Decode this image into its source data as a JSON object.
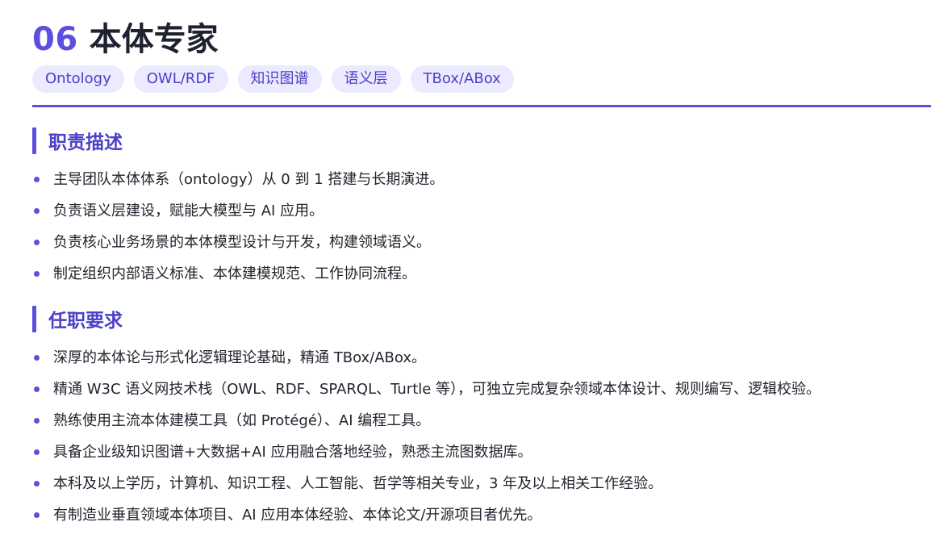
{
  "header": {
    "number": "06",
    "title": "本体专家"
  },
  "tags": [
    "Ontology",
    "OWL/RDF",
    "知识图谱",
    "语义层",
    "TBox/ABox"
  ],
  "sections": [
    {
      "title": "职责描述",
      "items": [
        "主导团队本体体系（ontology）从 0 到 1 搭建与长期演进。",
        "负责语义层建设，赋能大模型与 AI 应用。",
        "负责核心业务场景的本体模型设计与开发，构建领域语义。",
        "制定组织内部语义标准、本体建模规范、工作协同流程。"
      ]
    },
    {
      "title": "任职要求",
      "items": [
        "深厚的本体论与形式化逻辑理论基础，精通 TBox/ABox。",
        "精通 W3C 语义网技术栈（OWL、RDF、SPARQL、Turtle 等），可独立完成复杂领域本体设计、规则编写、逻辑校验。",
        "熟练使用主流本体建模工具（如 Protégé）、AI 编程工具。",
        "具备企业级知识图谱+大数据+AI 应用融合落地经验，熟悉主流图数据库。",
        "本科及以上学历，计算机、知识工程、人工智能、哲学等相关专业，3 年及以上相关工作经验。",
        "有制造业垂直领域本体项目、AI 应用本体经验、本体论文/开源项目者优先。"
      ]
    }
  ],
  "colors": {
    "accent": "#5b4ee0",
    "accent_text": "#4c40c8",
    "tag_bg": "#eceafe",
    "body_text": "#23252f"
  }
}
